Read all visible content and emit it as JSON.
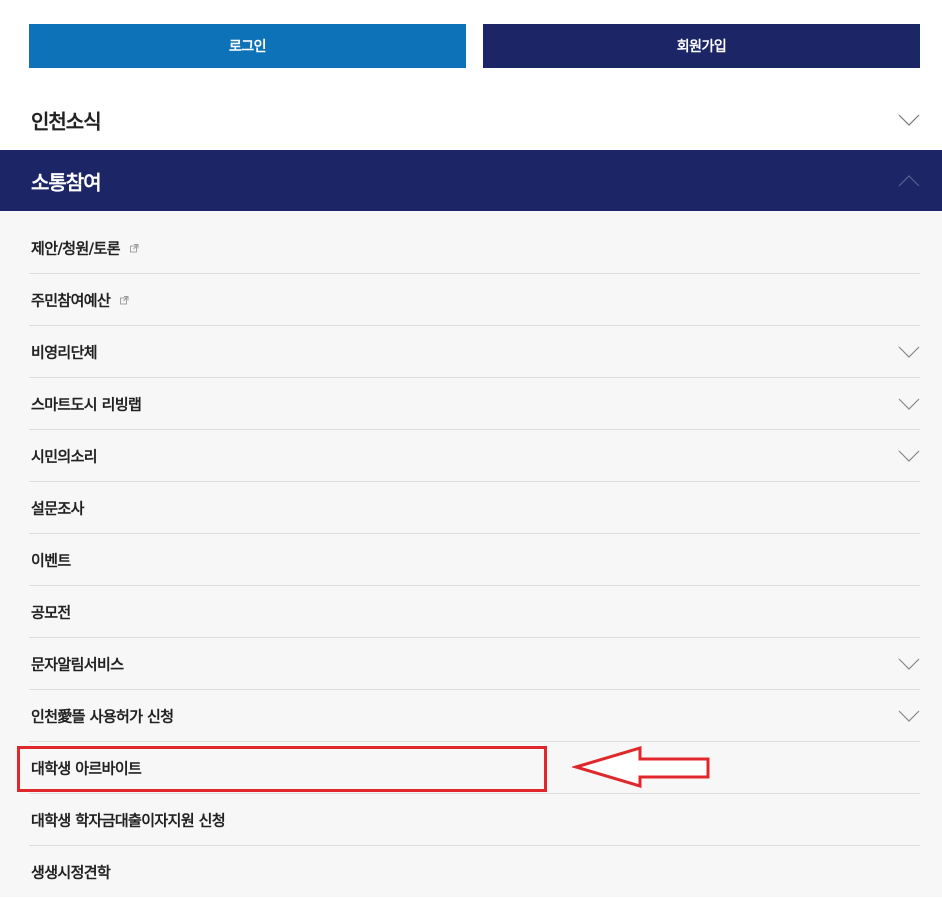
{
  "auth": {
    "login_label": "로그인",
    "signup_label": "회원가입"
  },
  "sections": {
    "incheon_news": {
      "label": "인천소식",
      "state": "collapsed"
    },
    "communication": {
      "label": "소통참여",
      "state": "expanded"
    }
  },
  "submenu": {
    "items": [
      {
        "label": "제안/청원/토론",
        "icon": "external-link-icon"
      },
      {
        "label": "주민참여예산",
        "icon": "external-link-icon"
      },
      {
        "label": "비영리단체",
        "icon": "chevron-down-icon"
      },
      {
        "label": "스마트도시 리빙랩",
        "icon": "chevron-down-icon"
      },
      {
        "label": "시민의소리",
        "icon": "chevron-down-icon"
      },
      {
        "label": "설문조사"
      },
      {
        "label": "이벤트"
      },
      {
        "label": "공모전"
      },
      {
        "label": "문자알림서비스",
        "icon": "chevron-down-icon"
      },
      {
        "label": "인천愛뜰 사용허가 신청",
        "icon": "chevron-down-icon"
      },
      {
        "label": "대학생 아르바이트",
        "highlighted": true
      },
      {
        "label": "대학생 학자금대출이자지원 신청"
      },
      {
        "label": "생생시정견학"
      }
    ]
  },
  "colors": {
    "login_button": "#0d72b8",
    "primary_navy": "#1c2566",
    "submenu_background": "#f7f7f7",
    "highlight_annotation": "#e0282c"
  }
}
